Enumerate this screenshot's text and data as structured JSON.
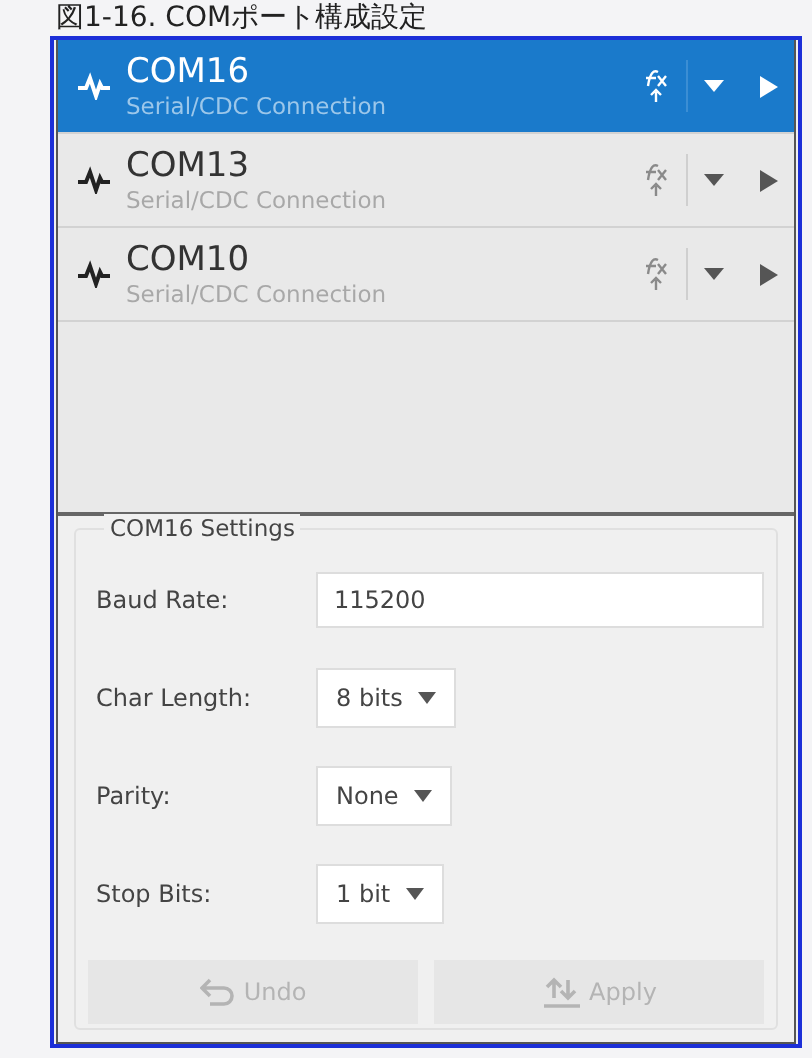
{
  "caption": "図1-16. COMポート構成設定",
  "ports": [
    {
      "name": "COM16",
      "subtitle": "Serial/CDC Connection",
      "selected": true
    },
    {
      "name": "COM13",
      "subtitle": "Serial/CDC Connection",
      "selected": false
    },
    {
      "name": "COM10",
      "subtitle": "Serial/CDC Connection",
      "selected": false
    }
  ],
  "settings": {
    "title": "COM16 Settings",
    "fields": [
      {
        "label": "Baud Rate:",
        "kind": "input",
        "value": "115200"
      },
      {
        "label": "Char Length:",
        "kind": "select",
        "value": "8 bits"
      },
      {
        "label": "Parity:",
        "kind": "select",
        "value": "None"
      },
      {
        "label": "Stop Bits:",
        "kind": "select",
        "value": "1 bit"
      }
    ],
    "buttons": [
      {
        "label": "Undo",
        "kind": "undo",
        "disabled": true
      },
      {
        "label": "Apply",
        "kind": "apply",
        "disabled": true
      }
    ]
  }
}
